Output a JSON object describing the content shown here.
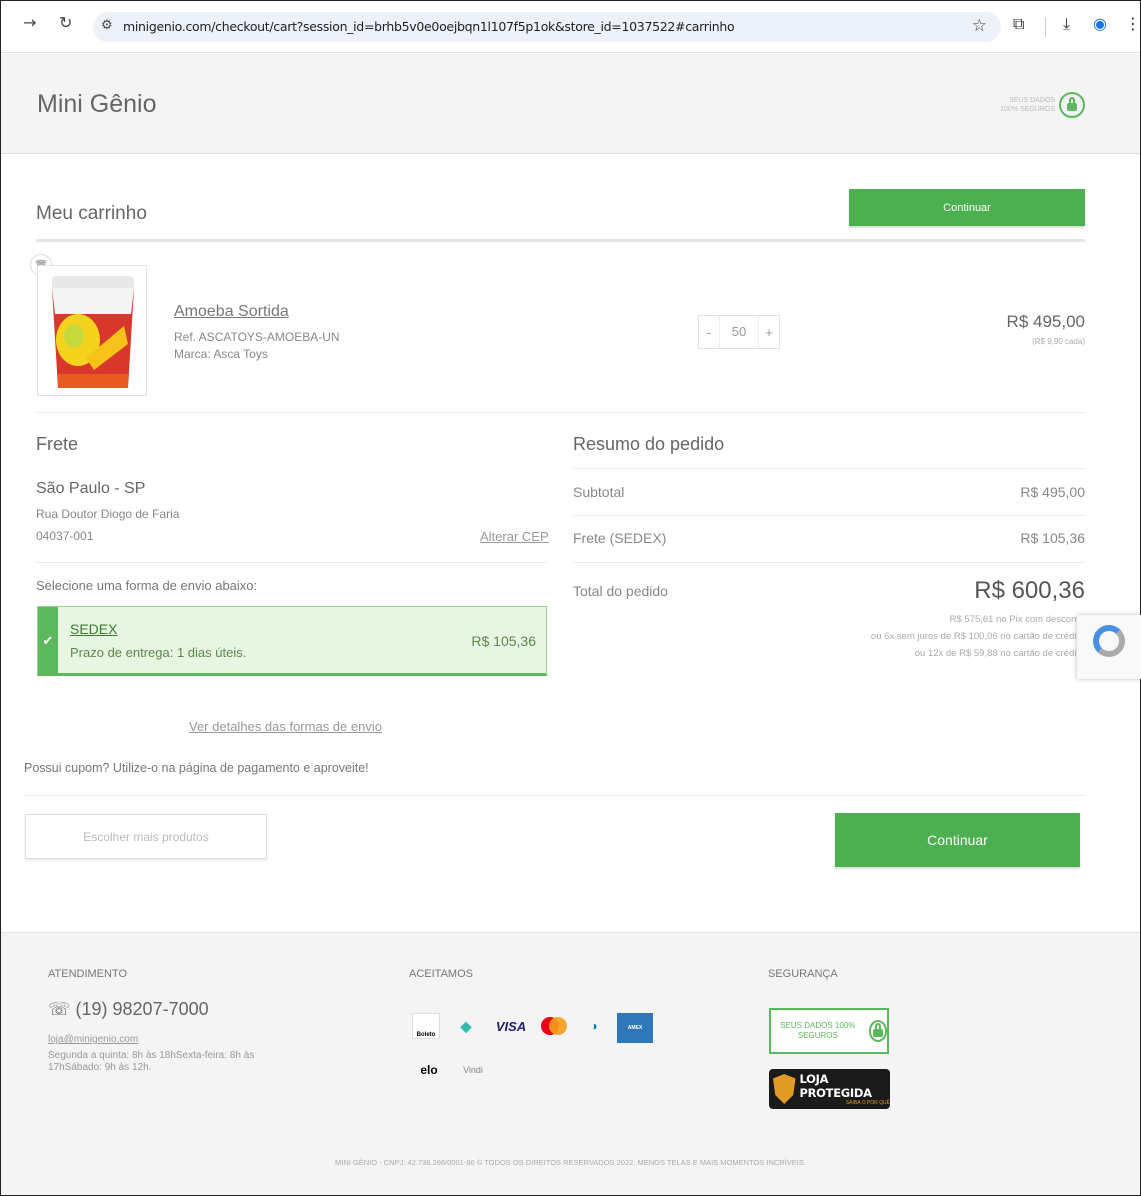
{
  "browser": {
    "url": "minigenio.com/checkout/cart?session_id=brhb5v0e0oejbqn1l107f5p1ok&store_id=1037522#carrinho"
  },
  "header": {
    "brand": "Mini Gênio",
    "secure_label": "SEUS DADOS 100% SEGUROS"
  },
  "cart": {
    "title": "Meu carrinho",
    "continue_label": "Continuar",
    "item": {
      "name": "Amoeba Sortida",
      "ref": "Ref. ASCATOYS-AMOEBA-UN",
      "brand": "Marca: Asca Toys",
      "quantity": "50",
      "qty_minus": "-",
      "qty_plus": "+",
      "price": "R$ 495,00",
      "unit_price": "(R$ 9,90 cada)"
    }
  },
  "shipping": {
    "title": "Frete",
    "city": "São Paulo - SP",
    "street": "Rua Doutor Diogo de Faria",
    "cep": "04037-001",
    "change_cep": "Alterar CEP",
    "select_label": "Selecione uma forma de envio abaixo:",
    "option": {
      "name": "SEDEX",
      "eta": "Prazo de entrega: 1 dias úteis.",
      "price": "R$ 105,36"
    },
    "details_link": "Ver detalhes das formas de envio",
    "coupon_text": "Possui cupom? Utilize-o na página de pagamento e aproveite!"
  },
  "summary": {
    "title": "Resumo do pedido",
    "subtotal_label": "Subtotal",
    "subtotal_value": "R$ 495,00",
    "freight_label": "Frete (SEDEX)",
    "freight_value": "R$ 105,36",
    "total_label": "Total do pedido",
    "total_value": "R$ 600,36",
    "notes": [
      "R$ 575,61 no Pix com descont",
      "ou 6x sem juros de R$ 100,06 no cartão de crédit",
      "ou 12x de R$ 59,88 no cartão de crédit"
    ]
  },
  "actions": {
    "more_products": "Escolher mais produtos",
    "continue": "Continuar"
  },
  "footer": {
    "support_title": "ATENDIMENTO",
    "phone": "(19) 98207-7000",
    "email": "loja@minigenio.com",
    "hours": "Segunda a quinta: 8h às 18hSexta-feira: 8h às 17hSábado: 9h às 12h.",
    "accept_title": "ACEITAMOS",
    "security_title": "SEGURANÇA",
    "secure_badge": "SEUS DADOS 100% SEGUROS",
    "loja_protegida": "LOJA PROTEGIDA",
    "loja_sub": "SAIBA O POR QUÊ",
    "payment_methods": [
      "Boleto",
      "Pix",
      "VISA",
      "Mastercard",
      "Diners Club",
      "American Express",
      "elo",
      "Vindi"
    ],
    "copyright": "MINI GÊNIO - CNPJ: 42.738.266/0001-86 © TODOS OS DIREITOS RESERVADOS 2022. MENOS TELAS E MAIS MOMENTOS INCRÍVEIS."
  },
  "colors": {
    "accent_green": "#4caf50",
    "shipping_bg": "#e8f5e2"
  }
}
